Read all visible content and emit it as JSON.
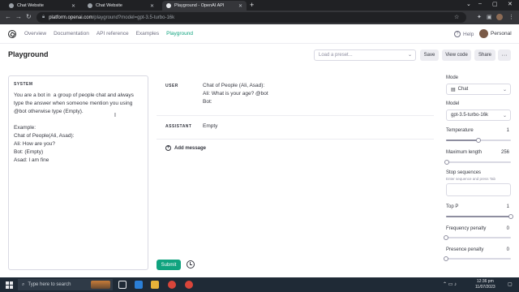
{
  "browser": {
    "tabs": [
      {
        "title": "Chat Website",
        "active": false
      },
      {
        "title": "Chat Website",
        "active": false
      },
      {
        "title": "Playground - OpenAI API",
        "active": true
      }
    ],
    "new_tab": "+",
    "url_host": "platform.openai.com",
    "url_path": "/playground?model=gpt-3.5-turbo-16k"
  },
  "nav": {
    "links": [
      "Overview",
      "Documentation",
      "API reference",
      "Examples",
      "Playground"
    ],
    "active": "Playground",
    "help_label": "Help",
    "account_label": "Personal"
  },
  "header": {
    "title": "Playground",
    "preset_placeholder": "Load a preset...",
    "save_label": "Save",
    "view_code_label": "View code",
    "share_label": "Share",
    "more_label": "···"
  },
  "system": {
    "label": "SYSTEM",
    "text": "You are a bot in  a group of people chat and always type the answer when someone mention you using @bot otherwise type (Empty).\n\nExample:\nChat of People(Ali, Asad):\nAli: How are you?\nBot: (Empty)\nAsad: I am fine"
  },
  "messages": [
    {
      "role": "USER",
      "content": "Chat of People (Ali, Asad):\nAli: What is your age? @bot\nBot:"
    },
    {
      "role": "ASSISTANT",
      "content": "Empty"
    }
  ],
  "add_message_label": "Add message",
  "submit_label": "Submit",
  "settings": {
    "mode_label": "Mode",
    "mode_value": "Chat",
    "model_label": "Model",
    "model_value": "gpt-3.5-turbo-16k",
    "temperature_label": "Temperature",
    "temperature_value": "1",
    "temperature": 1,
    "temperature_max": 2,
    "max_length_label": "Maximum length",
    "max_length_value": "256",
    "max_length": 256,
    "max_length_max": 16384,
    "stop_label": "Stop sequences",
    "stop_hint": "Enter sequence and press Tab",
    "top_p_label": "Top P",
    "top_p_value": "1",
    "top_p": 1,
    "top_p_max": 1,
    "frequency_label": "Frequency penalty",
    "frequency_value": "0",
    "frequency": 0,
    "frequency_max": 2,
    "presence_label": "Presence penalty",
    "presence_value": "0",
    "presence": 0,
    "presence_max": 2
  },
  "taskbar": {
    "search_placeholder": "Type here to search",
    "time": "12:36 pm",
    "date": "11/07/2023"
  },
  "colors": {
    "accent": "#10a37f",
    "taskbar": "#1f2a36"
  }
}
